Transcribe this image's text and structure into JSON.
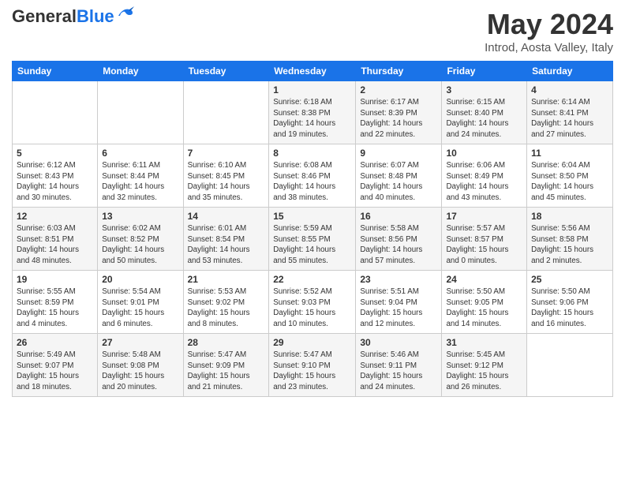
{
  "header": {
    "logo_general": "General",
    "logo_blue": "Blue",
    "month_title": "May 2024",
    "location": "Introd, Aosta Valley, Italy"
  },
  "weekdays": [
    "Sunday",
    "Monday",
    "Tuesday",
    "Wednesday",
    "Thursday",
    "Friday",
    "Saturday"
  ],
  "weeks": [
    [
      {
        "day": "",
        "info": ""
      },
      {
        "day": "",
        "info": ""
      },
      {
        "day": "",
        "info": ""
      },
      {
        "day": "1",
        "info": "Sunrise: 6:18 AM\nSunset: 8:38 PM\nDaylight: 14 hours\nand 19 minutes."
      },
      {
        "day": "2",
        "info": "Sunrise: 6:17 AM\nSunset: 8:39 PM\nDaylight: 14 hours\nand 22 minutes."
      },
      {
        "day": "3",
        "info": "Sunrise: 6:15 AM\nSunset: 8:40 PM\nDaylight: 14 hours\nand 24 minutes."
      },
      {
        "day": "4",
        "info": "Sunrise: 6:14 AM\nSunset: 8:41 PM\nDaylight: 14 hours\nand 27 minutes."
      }
    ],
    [
      {
        "day": "5",
        "info": "Sunrise: 6:12 AM\nSunset: 8:43 PM\nDaylight: 14 hours\nand 30 minutes."
      },
      {
        "day": "6",
        "info": "Sunrise: 6:11 AM\nSunset: 8:44 PM\nDaylight: 14 hours\nand 32 minutes."
      },
      {
        "day": "7",
        "info": "Sunrise: 6:10 AM\nSunset: 8:45 PM\nDaylight: 14 hours\nand 35 minutes."
      },
      {
        "day": "8",
        "info": "Sunrise: 6:08 AM\nSunset: 8:46 PM\nDaylight: 14 hours\nand 38 minutes."
      },
      {
        "day": "9",
        "info": "Sunrise: 6:07 AM\nSunset: 8:48 PM\nDaylight: 14 hours\nand 40 minutes."
      },
      {
        "day": "10",
        "info": "Sunrise: 6:06 AM\nSunset: 8:49 PM\nDaylight: 14 hours\nand 43 minutes."
      },
      {
        "day": "11",
        "info": "Sunrise: 6:04 AM\nSunset: 8:50 PM\nDaylight: 14 hours\nand 45 minutes."
      }
    ],
    [
      {
        "day": "12",
        "info": "Sunrise: 6:03 AM\nSunset: 8:51 PM\nDaylight: 14 hours\nand 48 minutes."
      },
      {
        "day": "13",
        "info": "Sunrise: 6:02 AM\nSunset: 8:52 PM\nDaylight: 14 hours\nand 50 minutes."
      },
      {
        "day": "14",
        "info": "Sunrise: 6:01 AM\nSunset: 8:54 PM\nDaylight: 14 hours\nand 53 minutes."
      },
      {
        "day": "15",
        "info": "Sunrise: 5:59 AM\nSunset: 8:55 PM\nDaylight: 14 hours\nand 55 minutes."
      },
      {
        "day": "16",
        "info": "Sunrise: 5:58 AM\nSunset: 8:56 PM\nDaylight: 14 hours\nand 57 minutes."
      },
      {
        "day": "17",
        "info": "Sunrise: 5:57 AM\nSunset: 8:57 PM\nDaylight: 15 hours\nand 0 minutes."
      },
      {
        "day": "18",
        "info": "Sunrise: 5:56 AM\nSunset: 8:58 PM\nDaylight: 15 hours\nand 2 minutes."
      }
    ],
    [
      {
        "day": "19",
        "info": "Sunrise: 5:55 AM\nSunset: 8:59 PM\nDaylight: 15 hours\nand 4 minutes."
      },
      {
        "day": "20",
        "info": "Sunrise: 5:54 AM\nSunset: 9:01 PM\nDaylight: 15 hours\nand 6 minutes."
      },
      {
        "day": "21",
        "info": "Sunrise: 5:53 AM\nSunset: 9:02 PM\nDaylight: 15 hours\nand 8 minutes."
      },
      {
        "day": "22",
        "info": "Sunrise: 5:52 AM\nSunset: 9:03 PM\nDaylight: 15 hours\nand 10 minutes."
      },
      {
        "day": "23",
        "info": "Sunrise: 5:51 AM\nSunset: 9:04 PM\nDaylight: 15 hours\nand 12 minutes."
      },
      {
        "day": "24",
        "info": "Sunrise: 5:50 AM\nSunset: 9:05 PM\nDaylight: 15 hours\nand 14 minutes."
      },
      {
        "day": "25",
        "info": "Sunrise: 5:50 AM\nSunset: 9:06 PM\nDaylight: 15 hours\nand 16 minutes."
      }
    ],
    [
      {
        "day": "26",
        "info": "Sunrise: 5:49 AM\nSunset: 9:07 PM\nDaylight: 15 hours\nand 18 minutes."
      },
      {
        "day": "27",
        "info": "Sunrise: 5:48 AM\nSunset: 9:08 PM\nDaylight: 15 hours\nand 20 minutes."
      },
      {
        "day": "28",
        "info": "Sunrise: 5:47 AM\nSunset: 9:09 PM\nDaylight: 15 hours\nand 21 minutes."
      },
      {
        "day": "29",
        "info": "Sunrise: 5:47 AM\nSunset: 9:10 PM\nDaylight: 15 hours\nand 23 minutes."
      },
      {
        "day": "30",
        "info": "Sunrise: 5:46 AM\nSunset: 9:11 PM\nDaylight: 15 hours\nand 24 minutes."
      },
      {
        "day": "31",
        "info": "Sunrise: 5:45 AM\nSunset: 9:12 PM\nDaylight: 15 hours\nand 26 minutes."
      },
      {
        "day": "",
        "info": ""
      }
    ]
  ]
}
